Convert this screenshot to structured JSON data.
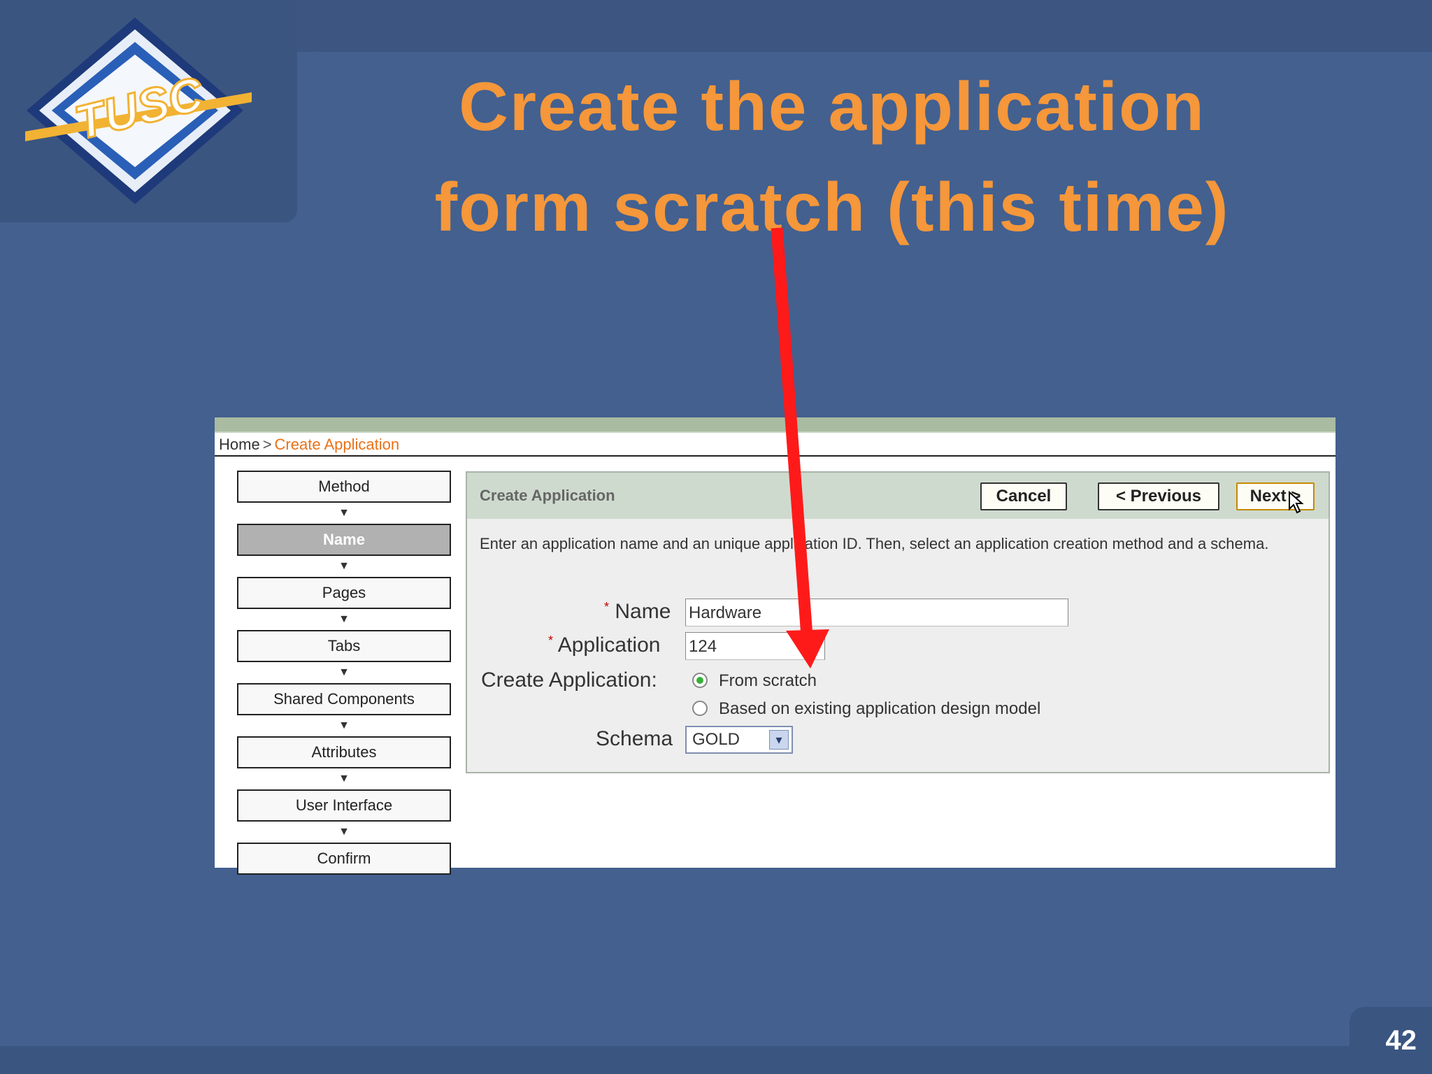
{
  "slide": {
    "title_line1": "Create the application",
    "title_line2": "form scratch (this time)",
    "page_number": "42",
    "logo_text": "TUSC"
  },
  "breadcrumb": {
    "home": "Home",
    "separator": ">",
    "current": "Create Application"
  },
  "steps": [
    "Method",
    "Name",
    "Pages",
    "Tabs",
    "Shared Components",
    "Attributes",
    "User Interface",
    "Confirm"
  ],
  "active_step": "Name",
  "panel": {
    "title": "Create Application",
    "cancel_label": "Cancel",
    "previous_label": "< Previous",
    "next_label": "Next >",
    "description": "Enter an application name and an unique application ID. Then, select an application creation method and a schema."
  },
  "form": {
    "name_label": "Name",
    "name_value": "Hardware",
    "app_label": "Application",
    "app_value": "124",
    "create_label": "Create Application:",
    "option_scratch": "From scratch",
    "option_existing": "Based on existing application design model",
    "selected_option": "From scratch",
    "schema_label": "Schema",
    "schema_value": "GOLD"
  },
  "colors": {
    "background": "#43608f",
    "title": "#f5973a",
    "annotation_arrow": "#ff1a1a",
    "breadcrumb_current": "#e8731a"
  },
  "icons": [
    "logo-diamond",
    "down-arrow",
    "mouse-cursor",
    "dropdown-chevron"
  ]
}
